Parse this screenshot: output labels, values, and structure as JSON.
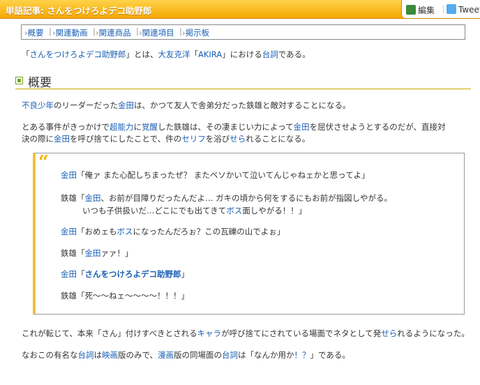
{
  "header": {
    "title": "単語記事: さんをつけろよデコ助野郎",
    "edit_label": "編集",
    "tweet_label": "Tweet"
  },
  "nav": {
    "items": [
      "概要",
      "関連動画",
      "関連商品",
      "関連項目",
      "掲示板"
    ]
  },
  "intro": {
    "q1": "「",
    "term": "さんをつけろよデコ助野郎",
    "q2": "」とは、",
    "author": "大友克洋",
    "q3": "「",
    "work": "AKIRA",
    "q4": "」における",
    "word": "台詞",
    "end": "である。"
  },
  "section_title": "概要",
  "p1": {
    "a": "不良少年",
    "b": "のリーダーだった",
    "c": "金田",
    "d": "は、かつて友人で舎弟分だった鉄雄と敵対することになる。"
  },
  "p2": {
    "l1a": "とある事件がきっかけで",
    "l1b": "超能力",
    "l1c": "に",
    "l1d": "覚醒",
    "l1e": "した鉄雄は、その凄まじい力によって",
    "l1f": "金田",
    "l1g": "を屈伏させようとするのだが、直接対",
    "l2a": "決の際に",
    "l2b": "金田",
    "l2c": "を呼び捨てにしたことで、件の",
    "l2d": "セリフ",
    "l2e": "を浴び",
    "l2f": "せら",
    "l2g": "れることになる。"
  },
  "quote": {
    "mark": "“",
    "q1a": "金田",
    "q1b": "「俺ァ また心配しちまったぜ？ またベソかいて泣いてんじゃねェかと思ってよ」",
    "q2a": "鉄雄「",
    "q2b": "金田",
    "q2c": "、お前が目障りだったんだよ… ガキの頃から何をするにもお前が指図しやがる。",
    "q2d": "いつも子供扱いだ…どこにでも出てきて",
    "q2e": "ボス",
    "q2f": "面しやがる！！」",
    "q3a": "金田",
    "q3b": "「おめェも",
    "q3c": "ボス",
    "q3d": "になったんだろぉ？この瓦礫の山でよぉ」",
    "q4a": "鉄雄「",
    "q4b": "金田",
    "q4c": "ァァ！」",
    "q5a": "金田",
    "q5b": "「",
    "q5c": "さんをつけろよデコ助野郎",
    "q5d": "」",
    "q6": "鉄雄「死〜〜ねェ〜〜〜〜！！！」"
  },
  "p3": {
    "a": "これが転じて、本来「さん」付けすべきとされる",
    "b": "キャラ",
    "c": "が呼び捨てにされている場面でネタとして発",
    "d": "せら",
    "e": "れるようになった。"
  },
  "p4": {
    "a": "なおこの有名な",
    "b": "台詞",
    "c": "は",
    "d": "映画",
    "e": "版のみで、",
    "f": "漫画",
    "g": "版の同場面の",
    "h": "台詞",
    "i": "は「なんか用か",
    "j": "！？",
    "k": "」である。"
  }
}
